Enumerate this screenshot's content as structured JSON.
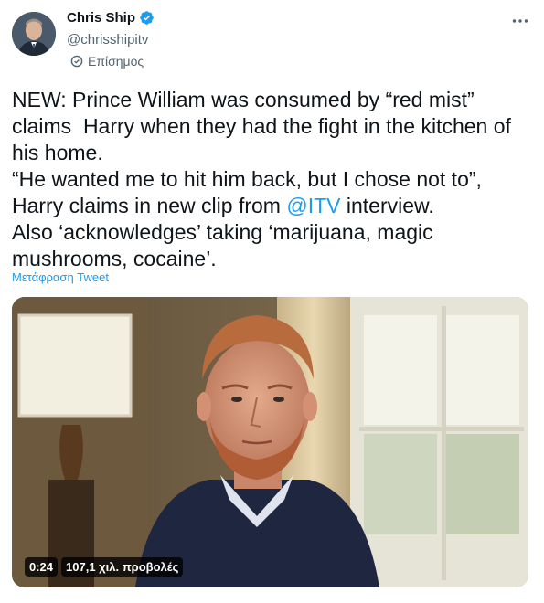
{
  "author": {
    "display_name": "Chris Ship",
    "handle": "@chrisshipitv",
    "official_label": "Επίσημος",
    "verified_icon": "verified-badge-icon",
    "official_icon": "official-check-icon"
  },
  "tweet": {
    "line1": "NEW: Prince William was consumed by “red mist”",
    "line2": "claims  Harry when they had the fight in the kitchen of",
    "line3": "his home.",
    "line4": "“He wanted me to hit him back, but I chose not to”,",
    "line5_before": "Harry claims in new clip from ",
    "line5_mention": "@ITV",
    "line5_after": " interview.",
    "line6": "Also ‘acknowledges’ taking ‘marijuana, magic",
    "line7": "mushrooms, cocaine’.",
    "translate_label": "Μετάφραση Tweet"
  },
  "video": {
    "duration": "0:24",
    "views": "107,1 χιλ. προβολές"
  },
  "colors": {
    "link": "#1d9bf0",
    "secondary_text": "#536471",
    "primary_text": "#0f1419"
  }
}
